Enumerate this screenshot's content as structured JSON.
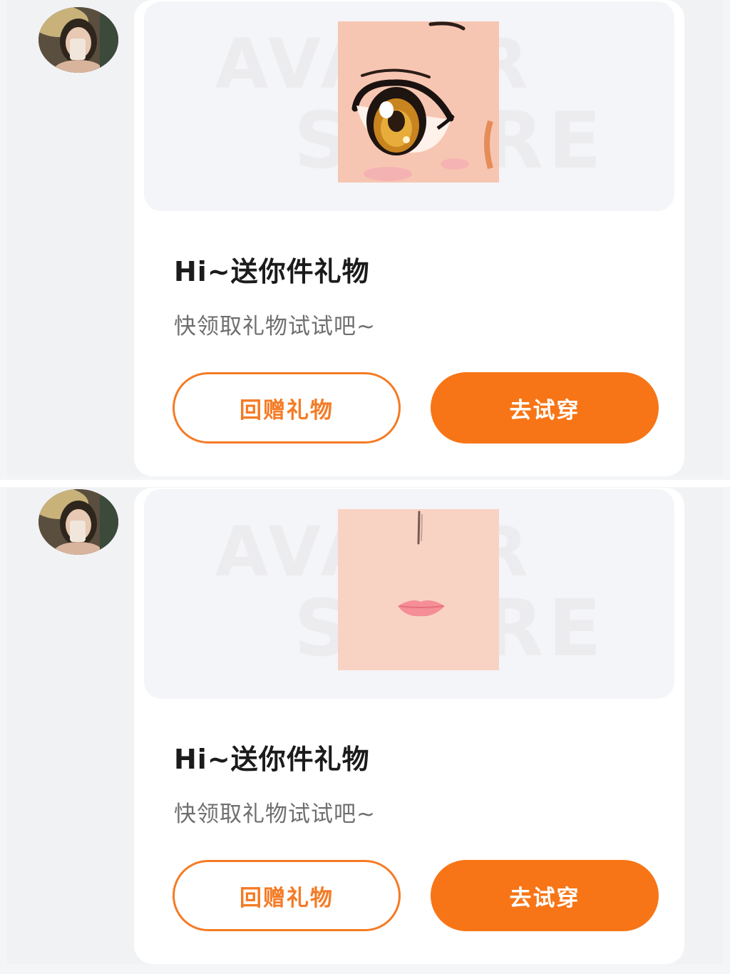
{
  "messages": [
    {
      "title": "Hi~送你件礼物",
      "subtitle": "快领取礼物试试吧~",
      "return_gift_label": "回赠礼物",
      "try_on_label": "去试穿",
      "preview_watermark_line1": "AVATAR",
      "preview_watermark_line2": "STORE",
      "gift_item_icon": "anime-eye-icon"
    },
    {
      "title": "Hi~送你件礼物",
      "subtitle": "快领取礼物试试吧~",
      "return_gift_label": "回赠礼物",
      "try_on_label": "去试穿",
      "preview_watermark_line1": "AVATAR",
      "preview_watermark_line2": "STORE",
      "gift_item_icon": "anime-mouth-icon"
    }
  ],
  "colors": {
    "accent": "#f77516",
    "outline": "#f47b25",
    "background": "#f4f5f7",
    "card": "#ffffff"
  }
}
